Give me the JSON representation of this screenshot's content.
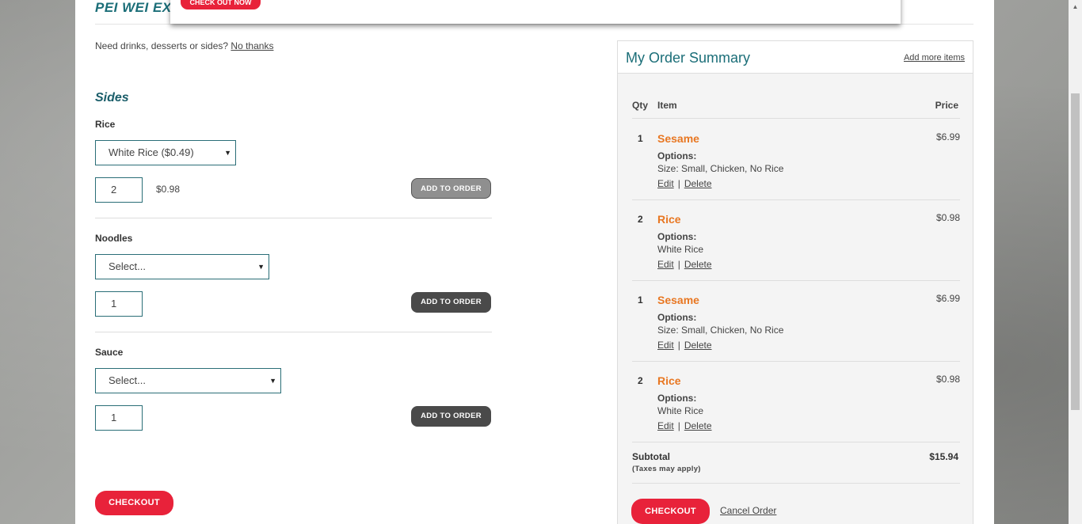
{
  "brand": "PEI WEI EXTI",
  "popup": {
    "checkout_now": "CHECK OUT NOW"
  },
  "upsell": {
    "prompt": "Need drinks, desserts or sides?",
    "no_thanks": "No thanks"
  },
  "sides": {
    "title": "Sides",
    "items": [
      {
        "label": "Rice",
        "selected": "White Rice ($0.49)",
        "qty": "2",
        "price": "$0.98",
        "add_label": "ADD TO ORDER"
      },
      {
        "label": "Noodles",
        "selected": "Select...",
        "qty": "1",
        "price": "",
        "add_label": "ADD TO ORDER"
      },
      {
        "label": "Sauce",
        "selected": "Select...",
        "qty": "1",
        "price": "",
        "add_label": "ADD TO ORDER"
      }
    ]
  },
  "checkout_label": "CHECKOUT",
  "summary": {
    "title": "My Order Summary",
    "add_more": "Add more items",
    "headers": {
      "qty": "Qty",
      "item": "Item",
      "price": "Price"
    },
    "options_label": "Options:",
    "edit": "Edit",
    "delete": "Delete",
    "rows": [
      {
        "qty": "1",
        "name": "Sesame",
        "options": "Size: Small, Chicken, No Rice",
        "price": "$6.99"
      },
      {
        "qty": "2",
        "name": "Rice",
        "options": "White Rice",
        "price": "$0.98"
      },
      {
        "qty": "1",
        "name": "Sesame",
        "options": "Size: Small, Chicken, No Rice",
        "price": "$6.99"
      },
      {
        "qty": "2",
        "name": "Rice",
        "options": "White Rice",
        "price": "$0.98"
      }
    ],
    "subtotal_label": "Subtotal",
    "taxes_note": "(Taxes may apply)",
    "subtotal_value": "$15.94",
    "checkout": "CHECKOUT",
    "cancel": "Cancel Order"
  }
}
